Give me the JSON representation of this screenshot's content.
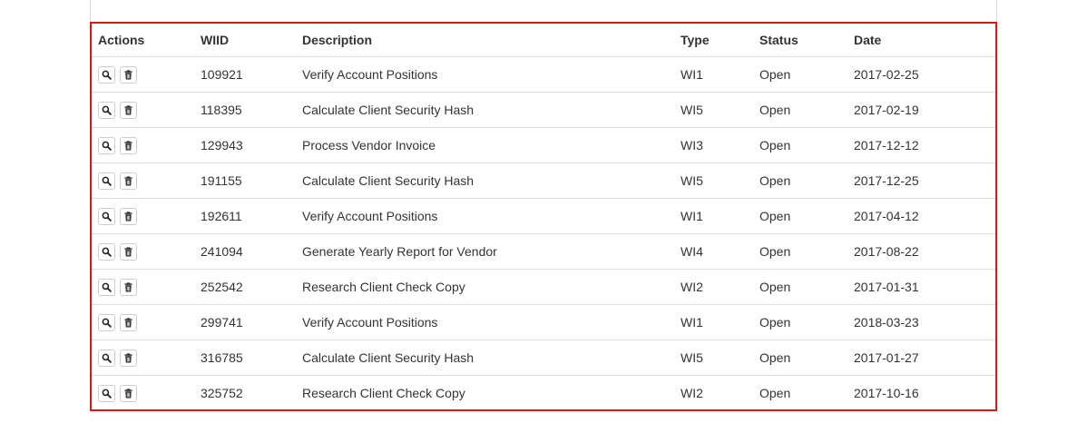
{
  "table": {
    "headers": {
      "actions": "Actions",
      "wiid": "WIID",
      "description": "Description",
      "type": "Type",
      "status": "Status",
      "date": "Date"
    },
    "rows": [
      {
        "wiid": "109921",
        "description": "Verify Account Positions",
        "type": "WI1",
        "status": "Open",
        "date": "2017-02-25"
      },
      {
        "wiid": "118395",
        "description": "Calculate Client Security Hash",
        "type": "WI5",
        "status": "Open",
        "date": "2017-02-19"
      },
      {
        "wiid": "129943",
        "description": "Process Vendor Invoice",
        "type": "WI3",
        "status": "Open",
        "date": "2017-12-12"
      },
      {
        "wiid": "191155",
        "description": "Calculate Client Security Hash",
        "type": "WI5",
        "status": "Open",
        "date": "2017-12-25"
      },
      {
        "wiid": "192611",
        "description": "Verify Account Positions",
        "type": "WI1",
        "status": "Open",
        "date": "2017-04-12"
      },
      {
        "wiid": "241094",
        "description": "Generate Yearly Report for Vendor",
        "type": "WI4",
        "status": "Open",
        "date": "2017-08-22"
      },
      {
        "wiid": "252542",
        "description": "Research Client Check Copy",
        "type": "WI2",
        "status": "Open",
        "date": "2017-01-31"
      },
      {
        "wiid": "299741",
        "description": "Verify Account Positions",
        "type": "WI1",
        "status": "Open",
        "date": "2018-03-23"
      },
      {
        "wiid": "316785",
        "description": "Calculate Client Security Hash",
        "type": "WI5",
        "status": "Open",
        "date": "2017-01-27"
      },
      {
        "wiid": "325752",
        "description": "Research Client Check Copy",
        "type": "WI2",
        "status": "Open",
        "date": "2017-10-16"
      }
    ],
    "row_actions": [
      {
        "icon": "search-icon"
      },
      {
        "icon": "trash-icon"
      }
    ]
  },
  "colors": {
    "highlight_border": "#d9141a",
    "row_divider": "#dddddd",
    "text": "#333333"
  }
}
